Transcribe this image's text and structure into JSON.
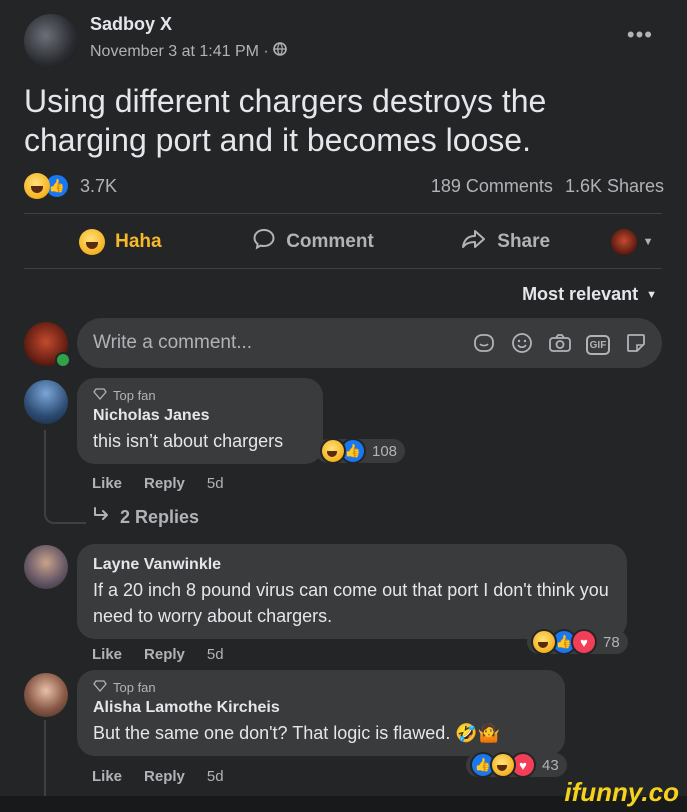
{
  "post": {
    "author": "Sadboy X",
    "timestamp": "November 3 at 1:41 PM ·",
    "privacy_icon": "globe-icon",
    "text": "Using different chargers destroys the charging port and it becomes loose.",
    "reaction_count": "3.7K",
    "comments": "189 Comments",
    "shares": "1.6K Shares"
  },
  "actions": {
    "haha": "Haha",
    "comment": "Comment",
    "share": "Share"
  },
  "sort_label": "Most relevant",
  "composer": {
    "placeholder": "Write a comment..."
  },
  "comments": [
    {
      "badge": "Top fan",
      "name": "Nicholas Janes",
      "text": "this isn’t about chargers",
      "reactions": "108",
      "like": "Like",
      "reply": "Reply",
      "time": "5d",
      "replies": "2 Replies"
    },
    {
      "name": "Layne Vanwinkle",
      "text": "If a 20 inch 8 pound virus can come out that port I don't think you need to worry about chargers.",
      "reactions": "78",
      "like": "Like",
      "reply": "Reply",
      "time": "5d"
    },
    {
      "badge": "Top fan",
      "name": "Alisha Lamothe Kircheis",
      "text": "But the same one don't? That logic is flawed. 🤣🤷",
      "reactions": "43",
      "like": "Like",
      "reply": "Reply",
      "time": "5d"
    }
  ],
  "watermark": "ifunny.co",
  "colors": {
    "background": "#242526",
    "bubble": "#3a3b3c",
    "haha": "#f7b928",
    "like": "#1877f2",
    "love": "#f33e58"
  }
}
